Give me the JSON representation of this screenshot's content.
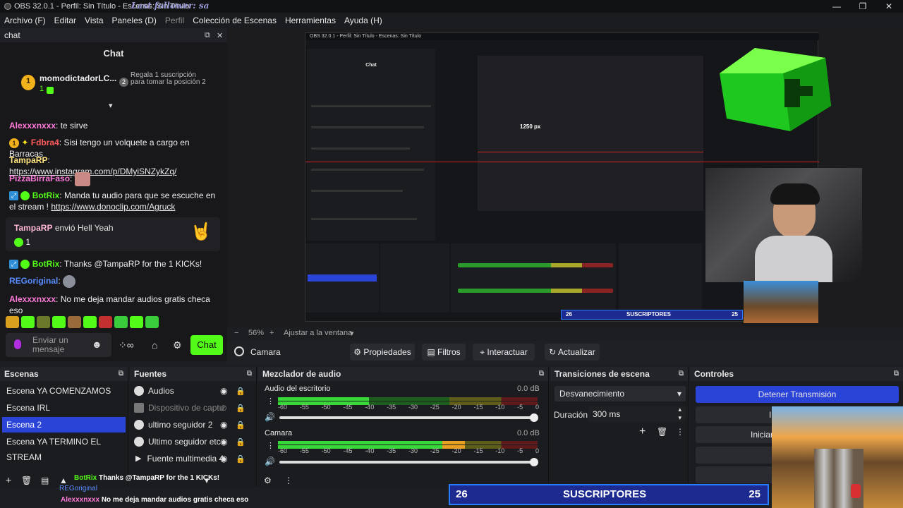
{
  "titlebar": {
    "title": "OBS 32.0.1 - Perfil: Sin Título - Escenas: Sin Título",
    "overlay": "Last follower: sa",
    "buttons": [
      "—",
      "❐",
      "✕"
    ]
  },
  "menu": [
    {
      "label": "Archivo (F)",
      "dim": false
    },
    {
      "label": "Editar",
      "dim": false
    },
    {
      "label": "Vista",
      "dim": false
    },
    {
      "label": "Paneles (D)",
      "dim": false
    },
    {
      "label": "Perfil",
      "dim": true
    },
    {
      "label": "Colección de Escenas",
      "dim": false
    },
    {
      "label": "Herramientas",
      "dim": false
    },
    {
      "label": "Ayuda (H)",
      "dim": false
    }
  ],
  "chat": {
    "dock_title": "chat",
    "title": "Chat",
    "pinned": {
      "rank": "1",
      "user": "momodictadorLC...",
      "count": "1",
      "rank2": "2",
      "cta": "Regala 1 suscripción para tomar la posición 2"
    },
    "messages": [
      {
        "user": "Alexxxnxxx",
        "text": "te sirve",
        "color": "#ff7ad9"
      },
      {
        "user": "Fdbra4",
        "text": "Sisi tengo un volquete a cargo en Barracas",
        "color": "#ff5a5a"
      },
      {
        "user": "TampaRP",
        "text": "https://www.instagram.com/p/DMyiSNZykZq/",
        "color": "#ffe27a"
      },
      {
        "user": "PizzaBirraFaso",
        "text": "",
        "color": "#ff7ad9"
      },
      {
        "user": "BotRix",
        "text": "Manda tu audio para que se escuche en el stream !",
        "link": "https://www.donoclip.com/Agruck",
        "color": "#53fc18"
      },
      {
        "user": "TampaRP",
        "text": "envió Hell Yeah",
        "count": "1",
        "color": "#ffb6d6"
      },
      {
        "user": "BotRix",
        "text": "Thanks @TampaRP for the 1 KICKs!",
        "color": "#53fc18"
      },
      {
        "user": "REGoriginal",
        "text": "",
        "color": "#5a8cff"
      },
      {
        "user": "Alexxxnxxx",
        "text": "No me deja mandar audios gratis checa eso",
        "color": "#ff7ad9"
      }
    ],
    "input_placeholder": "Enviar un mensaje",
    "send_label": "Chat"
  },
  "preview": {
    "zoom": "56%",
    "fit": "Ajustar a la ventana"
  },
  "source_toolbar": {
    "source": "Camara",
    "props": "Propiedades",
    "filters": "Filtros",
    "interact": "Interactuar",
    "refresh": "Actualizar"
  },
  "scenes": {
    "title": "Escenas",
    "items": [
      "Escena YA COMENZAMOS",
      "Escena IRL",
      "Escena 2",
      "Escena YA TERMINO EL STREAM"
    ],
    "selected": 2
  },
  "sources": {
    "title": "Fuentes",
    "items": [
      {
        "label": "Audios",
        "dim": false
      },
      {
        "label": "Dispositivo de captu",
        "dim": true
      },
      {
        "label": "ultimo seguidor 2",
        "dim": false
      },
      {
        "label": "Ultimo seguidor etc",
        "dim": false
      },
      {
        "label": "Fuente multimedia 4",
        "dim": false
      }
    ]
  },
  "mixer": {
    "title": "Mezclador de audio",
    "channels": [
      {
        "name": "Audio del escritorio",
        "db": "0.0 dB",
        "level": 0.35
      },
      {
        "name": "Camara",
        "db": "0.0 dB",
        "level": 0.72
      }
    ],
    "ticks": [
      "-60",
      "-55",
      "-50",
      "-45",
      "-40",
      "-35",
      "-30",
      "-25",
      "-20",
      "-15",
      "-10",
      "-5",
      "0"
    ]
  },
  "transitions": {
    "title": "Transiciones de escena",
    "selected": "Desvanecimiento",
    "duration_label": "Duración",
    "duration": "300 ms"
  },
  "controls": {
    "title": "Controles",
    "stop": "Detener Transmisión",
    "start_partial": "Iniciar",
    "other_partial": "I"
  },
  "subscribers": {
    "left": "26",
    "label": "SUSCRIPTORES",
    "right": "25"
  },
  "overlay_chat": [
    {
      "user": "BotRix",
      "text": "Thanks @TampaRP for the 1 KICKs!"
    },
    {
      "user": "REGoriginal",
      "text": ""
    },
    {
      "user": "Alexxxnxxx",
      "text": "No me deja mandar audios gratis checa eso"
    }
  ],
  "nested": {
    "title": "OBS 32.0.1 - Perfil: Sin Título - Escenas: Sin Título",
    "chat": "Chat",
    "tag": "1250 px"
  }
}
